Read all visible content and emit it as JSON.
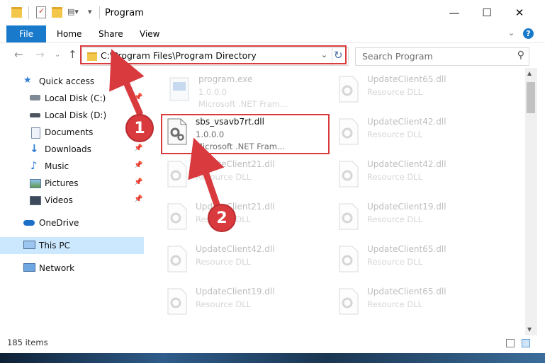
{
  "window": {
    "title": "Program",
    "controls": {
      "minimize": "—",
      "maximize": "☐",
      "close": "✕"
    }
  },
  "ribbon": {
    "tabs": [
      "File",
      "Home",
      "Share",
      "View"
    ],
    "help": "?"
  },
  "nav": {
    "address": "C:\\Program Files\\Program Directory",
    "search_placeholder": "Search Program"
  },
  "sidebar": {
    "items": [
      {
        "label": "Quick access",
        "icon": "star-icon",
        "pinned": false
      },
      {
        "label": "Local Disk (C:)",
        "icon": "drive-icon",
        "pinned": true
      },
      {
        "label": "Local Disk (D:)",
        "icon": "drive-icon",
        "pinned": false
      },
      {
        "label": "Documents",
        "icon": "documents-icon",
        "pinned": true
      },
      {
        "label": "Downloads",
        "icon": "download-icon",
        "pinned": true
      },
      {
        "label": "Music",
        "icon": "music-icon",
        "pinned": true
      },
      {
        "label": "Pictures",
        "icon": "pictures-icon",
        "pinned": true
      },
      {
        "label": "Videos",
        "icon": "videos-icon",
        "pinned": true
      },
      {
        "label": "OneDrive",
        "icon": "cloud-icon",
        "pinned": false
      },
      {
        "label": "This PC",
        "icon": "computer-icon",
        "pinned": false,
        "selected": true
      },
      {
        "label": "Network",
        "icon": "network-icon",
        "pinned": false
      }
    ]
  },
  "files": [
    {
      "name": "program.exe",
      "version": "1.0.0.0",
      "desc": "Microsoft .NET Fram..."
    },
    {
      "name": "UpdateClient65.dll",
      "desc": "Resource DLL"
    },
    {
      "name": "sbs_vsavb7rt.dll",
      "version": "1.0.0.0",
      "desc": "Microsoft .NET Fram...",
      "highlighted": true
    },
    {
      "name": "UpdateClient42.dll",
      "desc": "Resource DLL"
    },
    {
      "name": "UpdateClient21.dll",
      "desc": "Resource DLL"
    },
    {
      "name": "UpdateClient42.dll",
      "desc": "Resource DLL"
    },
    {
      "name": "UpdateClient21.dll",
      "desc": "Resource DLL"
    },
    {
      "name": "UpdateClient19.dll",
      "desc": "Resource DLL"
    },
    {
      "name": "UpdateClient42.dll",
      "desc": "Resource DLL"
    },
    {
      "name": "UpdateClient65.dll",
      "desc": "Resource DLL"
    },
    {
      "name": "UpdateClient19.dll",
      "desc": "Resource DLL"
    },
    {
      "name": "UpdateClient65.dll",
      "desc": "Resource DLL"
    }
  ],
  "status": {
    "item_count": "185 items"
  },
  "callouts": [
    "1",
    "2"
  ],
  "colors": {
    "accent": "#1979ca",
    "callout": "#d93a3e",
    "selection": "#cce8ff"
  }
}
